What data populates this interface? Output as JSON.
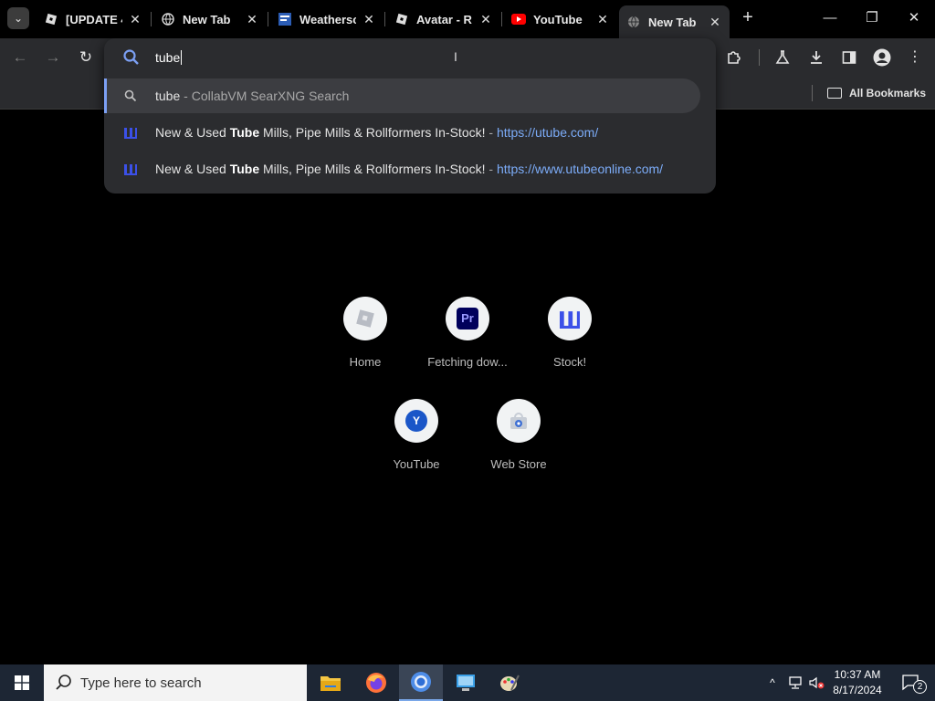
{
  "tabs": [
    {
      "title": "[UPDATE 4",
      "favicon": "roblox-icon"
    },
    {
      "title": "New Tab",
      "favicon": "globe-icon"
    },
    {
      "title": "Weathersc",
      "favicon": "weather-channel-icon"
    },
    {
      "title": "Avatar - R",
      "favicon": "roblox-icon"
    },
    {
      "title": "YouTube",
      "favicon": "youtube-icon"
    },
    {
      "title": "New Tab",
      "favicon": "globe-icon",
      "active": true
    }
  ],
  "bookmarks_bar": {
    "all_bookmarks": "All Bookmarks"
  },
  "omnibox": {
    "value": "tube",
    "suggestions": [
      {
        "query": "tube",
        "separator": " - ",
        "source": "CollabVM SearXNG Search",
        "icon": "search-icon"
      },
      {
        "before": "New & Used ",
        "bold": "Tube",
        "after": " Mills, Pipe Mills & Rollformers In-Stock!",
        "separator": " - ",
        "url": "https://utube.com/",
        "icon": "utube-logo-icon"
      },
      {
        "before": "New & Used ",
        "bold": "Tube",
        "after": " Mills, Pipe Mills & Rollformers In-Stock!",
        "separator": " - ",
        "url": "https://www.utubeonline.com/",
        "icon": "utube-logo-icon"
      }
    ]
  },
  "shortcuts": [
    {
      "label": "Home",
      "icon": "roblox-icon"
    },
    {
      "label": "Fetching dow...",
      "icon": "premiere-pro-icon",
      "icon_text": "Pr"
    },
    {
      "label": "Stock!",
      "icon": "utube-logo-icon"
    },
    {
      "label": "YouTube",
      "icon": "letter-y-icon",
      "icon_text": "Y"
    },
    {
      "label": "Web Store",
      "icon": "chrome-web-store-icon"
    }
  ],
  "taskbar": {
    "search_placeholder": "Type here to search",
    "time": "10:37 AM",
    "date": "8/17/2024",
    "notification_count": "2"
  },
  "colors": {
    "background": "#000000",
    "toolbar": "#2a2b2e",
    "accent_link": "#7cacf8",
    "taskbar": "#1d2634"
  }
}
